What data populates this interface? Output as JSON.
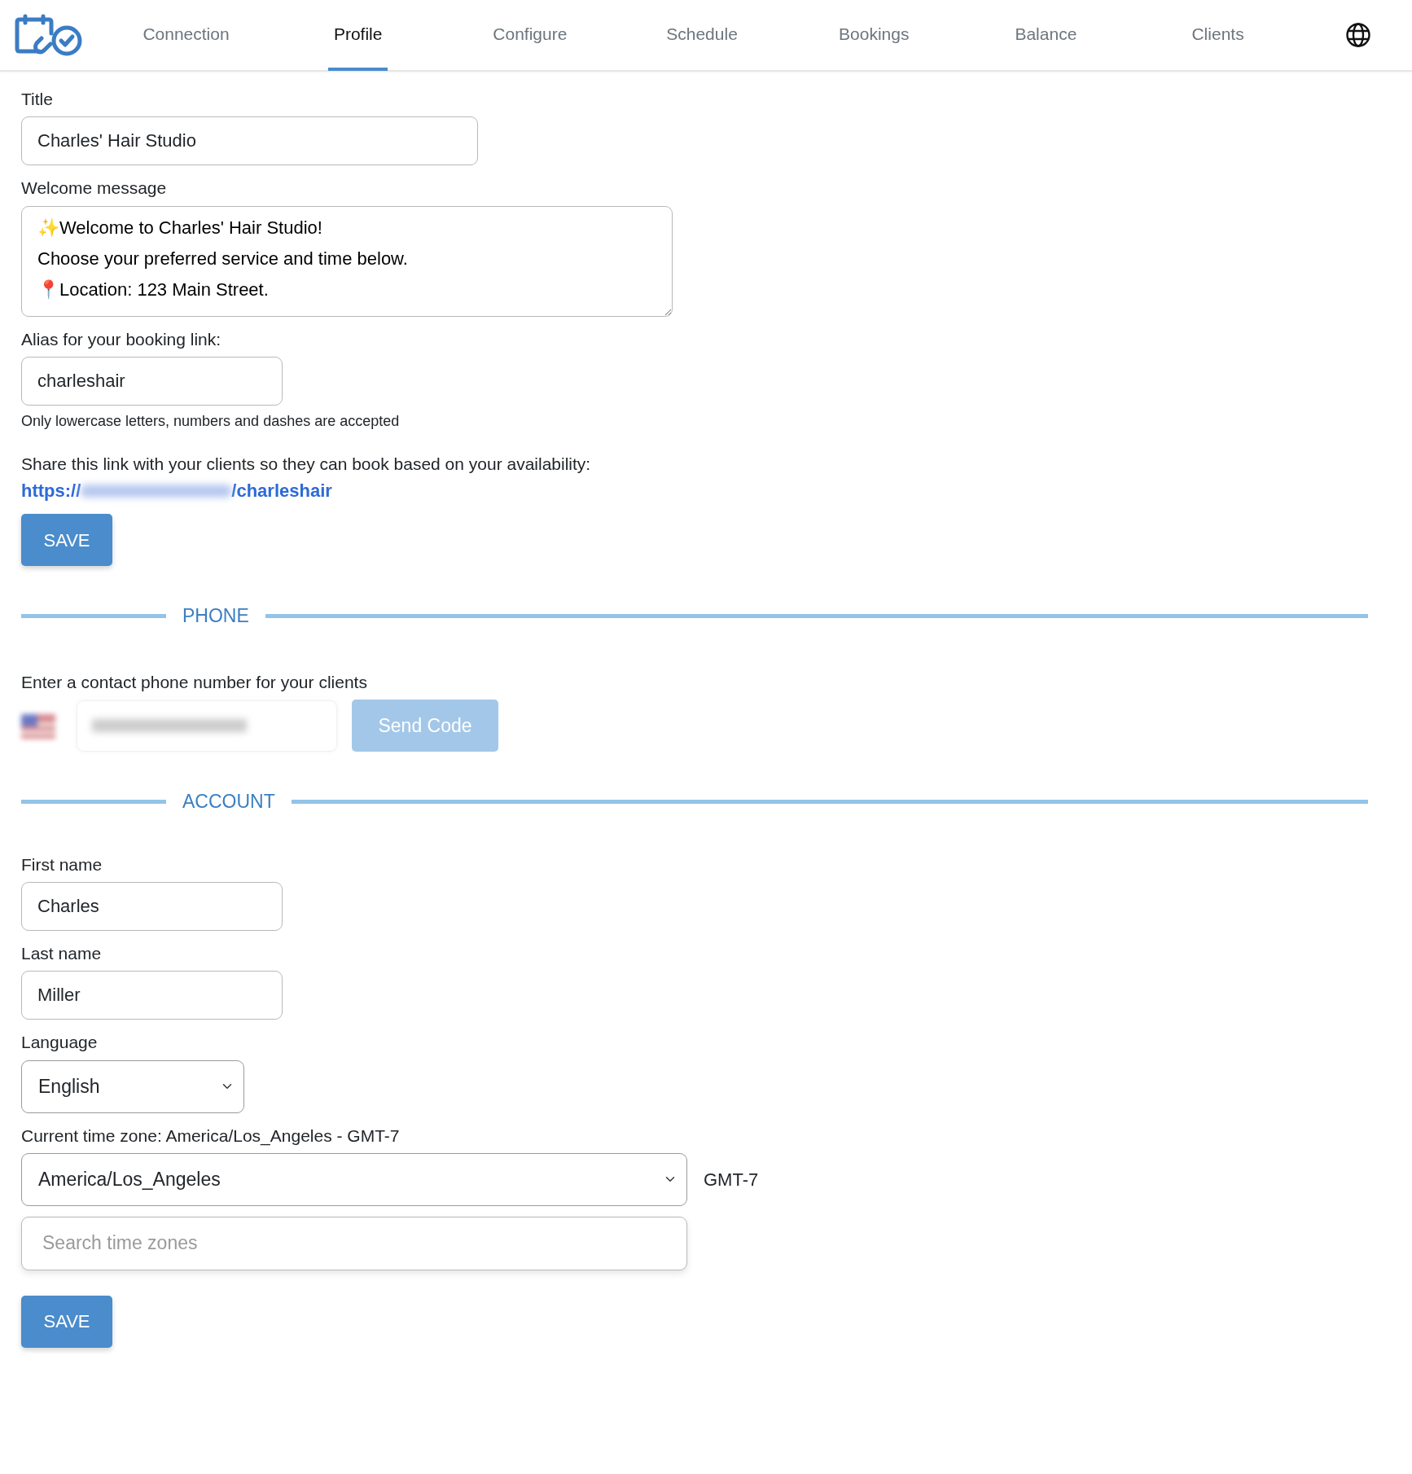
{
  "nav": {
    "tabs": [
      {
        "label": "Connection",
        "selected": false
      },
      {
        "label": "Profile",
        "selected": true
      },
      {
        "label": "Configure",
        "selected": false
      },
      {
        "label": "Schedule",
        "selected": false
      },
      {
        "label": "Bookings",
        "selected": false
      },
      {
        "label": "Balance",
        "selected": false
      },
      {
        "label": "Clients",
        "selected": false
      }
    ]
  },
  "profile": {
    "title_label": "Title",
    "title_value": "Charles' Hair Studio",
    "welcome_label": "Welcome message",
    "welcome_lines": [
      "✨Welcome to Charles' Hair Studio!",
      "Choose your preferred service and time below.",
      "📍Location: 123 Main Street."
    ],
    "alias_label": "Alias for your booking link:",
    "alias_value": "charleshair",
    "alias_hint": "Only lowercase letters, numbers and dashes are accepted",
    "share_text": "Share this link with your clients so they can book based on your availability:",
    "link_start": "https://",
    "link_end": "/charleshair",
    "save_button": "SAVE"
  },
  "phone": {
    "heading": "PHONE",
    "prompt": "Enter a contact phone number for your clients",
    "send_button": "Send Code",
    "send_disabled": true
  },
  "account": {
    "heading": "ACCOUNT",
    "first_name_label": "First name",
    "first_name": "Charles",
    "last_name_label": "Last name",
    "last_name": "Miller",
    "language_label": "Language",
    "language": "English",
    "timezone_label": "Current time zone: America/Los_Angeles - GMT-7",
    "timezone": "America/Los_Angeles",
    "timezone_offset": "GMT-7",
    "search": {
      "placeholder": "Search time zones"
    },
    "save_button": "SAVE"
  }
}
